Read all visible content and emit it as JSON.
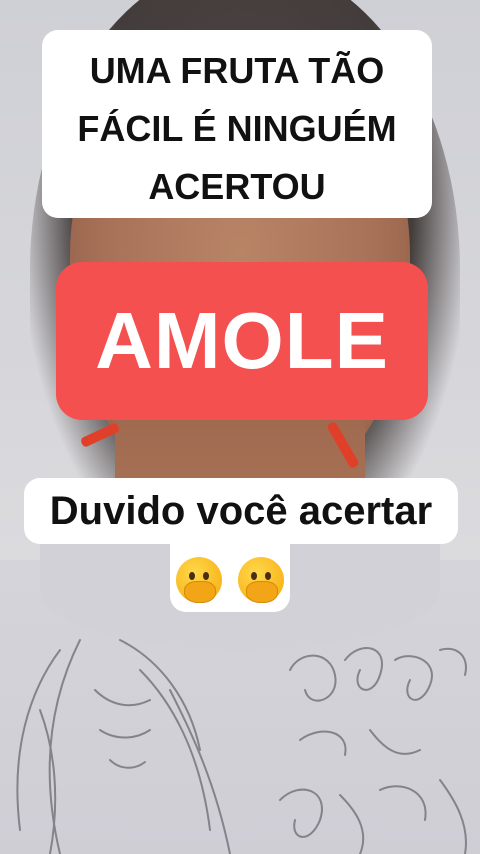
{
  "caption_top": {
    "line1": "UMA FRUTA TÃO",
    "line2": "FÁCIL É NINGUÉM",
    "line3": "ACERTOU"
  },
  "answer": {
    "text": "AMOLE",
    "background_color": "#f4504f"
  },
  "caption_bottom": {
    "text": "Duvido você acertar"
  },
  "emoji": {
    "icons": [
      "hand-over-mouth-face-icon",
      "hand-over-mouth-face-icon"
    ]
  }
}
